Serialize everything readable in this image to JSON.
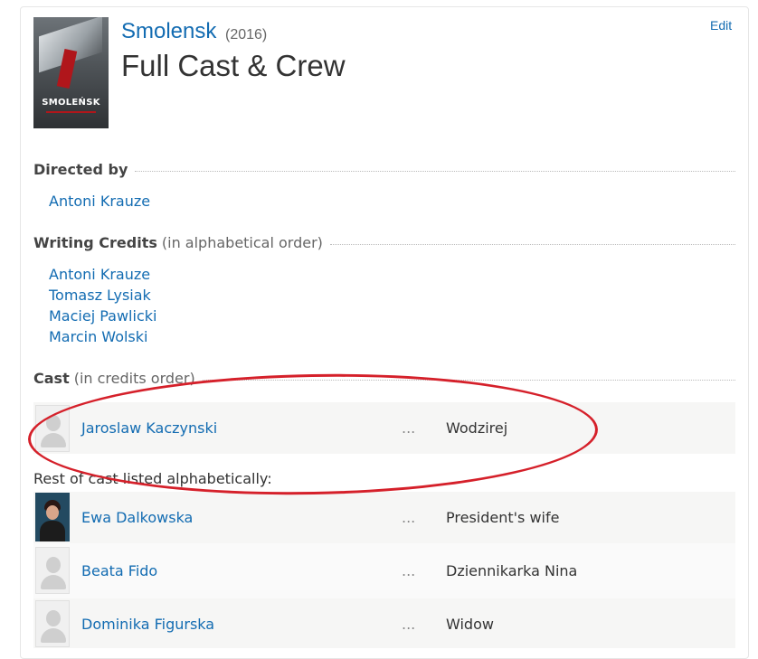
{
  "header": {
    "movie_title": "Smolensk",
    "year": "(2016)",
    "page_title": "Full Cast & Crew",
    "edit_label": "Edit",
    "poster_title": "SMOLEŃSK"
  },
  "directed": {
    "heading": "Directed by",
    "names": [
      "Antoni Krauze"
    ]
  },
  "writing": {
    "heading": "Writing Credits",
    "note": "(in alphabetical order)",
    "names": [
      "Antoni Krauze",
      "Tomasz Lysiak",
      "Maciej Pawlicki",
      "Marcin Wolski"
    ]
  },
  "cast": {
    "heading": "Cast",
    "note": "(in credits order)",
    "ellipsis": "...",
    "main": [
      {
        "actor": "Jaroslaw Kaczynski",
        "character": "Wodzirej"
      }
    ],
    "rest_label": "Rest of cast listed alphabetically:",
    "rest": [
      {
        "actor": "Ewa Dalkowska",
        "character": "President's wife"
      },
      {
        "actor": "Beata Fido",
        "character": "Dziennikarka Nina"
      },
      {
        "actor": "Dominika Figurska",
        "character": "Widow"
      }
    ]
  },
  "colors": {
    "link": "#136cb2",
    "annotation": "#d5202a"
  }
}
